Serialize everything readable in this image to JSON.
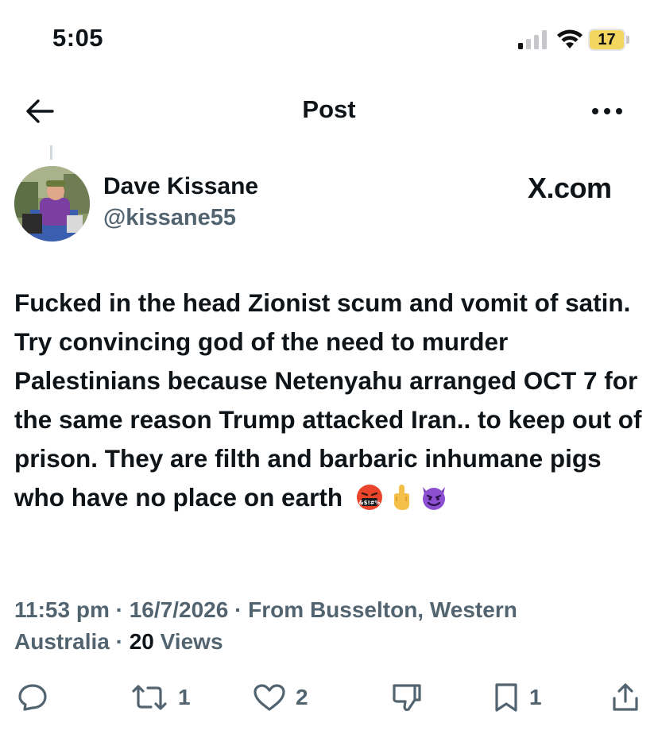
{
  "status_bar": {
    "time": "5:05",
    "battery_level": "17",
    "battery_color": "#f2d660"
  },
  "nav": {
    "title": "Post",
    "back_icon": "arrow-left-icon",
    "more_icon": "more-horizontal-icon"
  },
  "author": {
    "name": "Dave Kissane",
    "handle": "@kissane55"
  },
  "source_label": "X.com",
  "post": {
    "text": "Fucked in the head Zionist scum and vomit of satin. Try convincing god of the need to murder Palestinians because Netenyahu arranged OCT 7 for the same reason Trump attacked Iran.. to keep out of prison. They are filth and barbaric inhumane pigs who have no place on earth",
    "emojis": [
      "🤬",
      "🖕",
      "😈"
    ]
  },
  "meta": {
    "line1": "11:53 pm · 16/7/2026 · From Busselton, Western",
    "line2_prefix": "Australia · ",
    "views_count": "20",
    "views_label": " Views"
  },
  "actions": {
    "reply_count": "",
    "retweet_count": "1",
    "like_count": "2",
    "bookmark_count": "1"
  }
}
